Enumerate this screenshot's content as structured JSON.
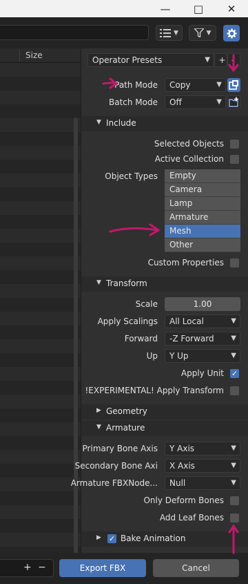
{
  "window": {
    "minimize_label": "—",
    "maximize_label": "□",
    "close_label": "✕"
  },
  "header": {
    "display_mode_icon": "list-view-icon",
    "filter_icon": "filter-icon",
    "settings_icon": "gear-icon"
  },
  "filelist": {
    "column_size_label": "Size"
  },
  "presets": {
    "label": "Operator Presets",
    "add_label": "+",
    "remove_label": "-"
  },
  "path_mode": {
    "label": "Path Mode",
    "value": "Copy"
  },
  "batch_mode": {
    "label": "Batch Mode",
    "value": "Off"
  },
  "include": {
    "title": "Include",
    "selected_objects_label": "Selected Objects",
    "active_collection_label": "Active Collection",
    "object_types_label": "Object Types",
    "object_types": [
      {
        "label": "Empty"
      },
      {
        "label": "Camera"
      },
      {
        "label": "Lamp"
      },
      {
        "label": "Armature"
      },
      {
        "label": "Mesh"
      },
      {
        "label": "Other"
      }
    ],
    "custom_properties_label": "Custom Properties"
  },
  "transform": {
    "title": "Transform",
    "scale_label": "Scale",
    "scale_value": "1.00",
    "apply_scalings_label": "Apply Scalings",
    "apply_scalings_value": "All Local",
    "forward_label": "Forward",
    "forward_value": "-Z Forward",
    "up_label": "Up",
    "up_value": "Y Up",
    "apply_unit_label": "Apply Unit",
    "apply_transform_label": "!EXPERIMENTAL! Apply Transform"
  },
  "geometry": {
    "title": "Geometry"
  },
  "armature": {
    "title": "Armature",
    "primary_bone_axis_label": "Primary Bone Axis",
    "primary_bone_axis_value": "Y Axis",
    "secondary_bone_axis_label": "Secondary Bone Axi",
    "secondary_bone_axis_value": "X Axis",
    "fbx_node_type_label": "Armature FBXNode...",
    "fbx_node_type_value": "Null",
    "only_deform_bones_label": "Only Deform Bones",
    "add_leaf_bones_label": "Add Leaf Bones"
  },
  "bake_animation": {
    "title": "Bake Animation"
  },
  "footer": {
    "plus_label": "+",
    "minus_label": "−",
    "export_label": "Export FBX",
    "cancel_label": "Cancel"
  },
  "colors": {
    "accent": "#4772b3",
    "annotation_arrow": "#c2186b"
  }
}
